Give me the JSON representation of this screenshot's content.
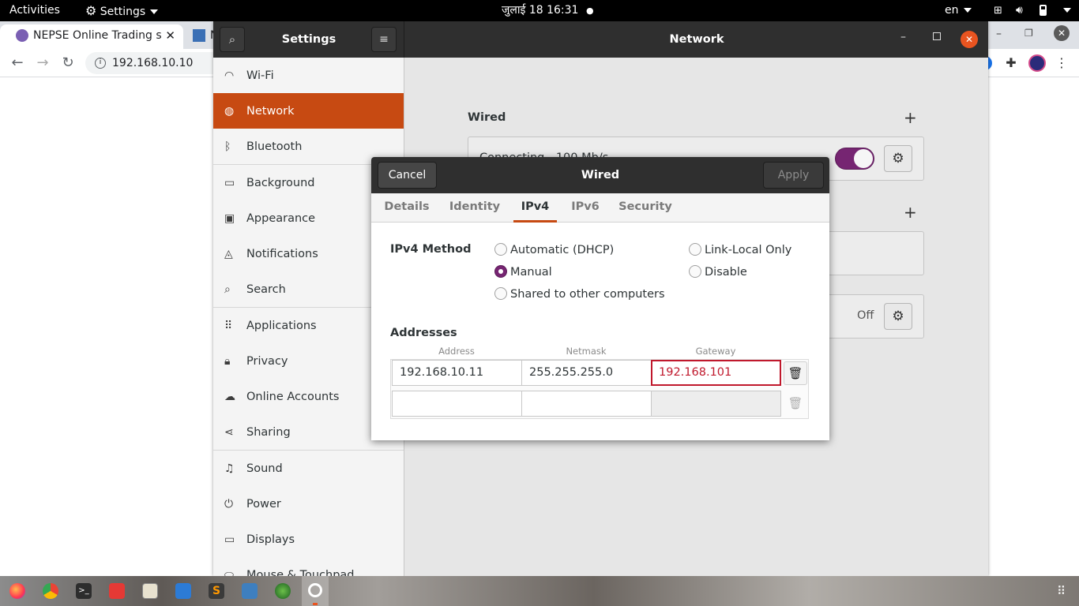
{
  "topbar": {
    "activities": "Activities",
    "app_menu": "Settings",
    "clock": "जुलाई 18  16:31",
    "lang": "en"
  },
  "browser": {
    "tabs": [
      {
        "title": "NEPSE Online Trading s"
      },
      {
        "title": "N"
      }
    ],
    "address": "192.168.10.10"
  },
  "settings": {
    "header_title": "Settings",
    "panel_title": "Network",
    "sidebar": [
      {
        "label": "Wi-Fi",
        "icon": "wifi-icon"
      },
      {
        "label": "Network",
        "icon": "network-icon",
        "active": true
      },
      {
        "label": "Bluetooth",
        "icon": "bluetooth-icon"
      },
      {
        "label": "Background",
        "icon": "background-icon"
      },
      {
        "label": "Appearance",
        "icon": "appearance-icon"
      },
      {
        "label": "Notifications",
        "icon": "bell-icon"
      },
      {
        "label": "Search",
        "icon": "search-icon"
      },
      {
        "label": "Applications",
        "icon": "grid-icon"
      },
      {
        "label": "Privacy",
        "icon": "lock-icon"
      },
      {
        "label": "Online Accounts",
        "icon": "cloud-icon"
      },
      {
        "label": "Sharing",
        "icon": "share-icon"
      },
      {
        "label": "Sound",
        "icon": "music-note-icon"
      },
      {
        "label": "Power",
        "icon": "power-icon"
      },
      {
        "label": "Displays",
        "icon": "display-icon"
      },
      {
        "label": "Mouse & Touchpad",
        "icon": "mouse-icon"
      }
    ],
    "wired": {
      "heading": "Wired",
      "status": "Connecting - 100 Mb/s",
      "toggle_on": true
    },
    "proxy_status": "Off"
  },
  "dialog": {
    "title": "Wired",
    "cancel": "Cancel",
    "apply": "Apply",
    "tabs": [
      "Details",
      "Identity",
      "IPv4",
      "IPv6",
      "Security"
    ],
    "active_tab": "IPv4",
    "method_label": "IPv4 Method",
    "methods": {
      "automatic": "Automatic (DHCP)",
      "link_local": "Link-Local Only",
      "manual": "Manual",
      "disable": "Disable",
      "shared": "Shared to other computers"
    },
    "selected_method": "Manual",
    "addresses_label": "Addresses",
    "columns": {
      "address": "Address",
      "netmask": "Netmask",
      "gateway": "Gateway"
    },
    "rows": [
      {
        "address": "192.168.10.11",
        "netmask": "255.255.255.0",
        "gateway": "192.168.101"
      },
      {
        "address": "",
        "netmask": "",
        "gateway": ""
      }
    ]
  },
  "colors": {
    "accent": "#c74a12",
    "toggle": "#762572",
    "error": "#c0182c",
    "titlebar": "#2f2f2f"
  }
}
